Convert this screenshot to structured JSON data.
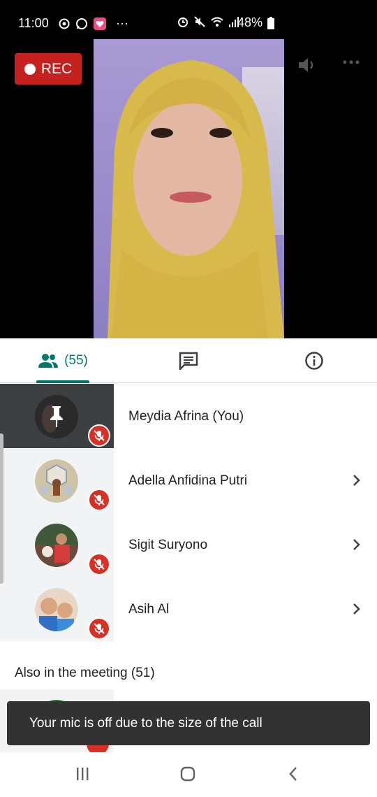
{
  "status_bar": {
    "time": "11:00",
    "overflow": "···",
    "battery": "48%",
    "icons_left": [
      "circle-play-icon",
      "whatsapp-icon",
      "heart-app-icon"
    ],
    "icons_right": [
      "alarm-icon",
      "mute-icon",
      "wifi-icon",
      "signal-icon",
      "battery-icon"
    ]
  },
  "video": {
    "rec_label": "REC",
    "controls": [
      "speaker-icon",
      "more-icon"
    ]
  },
  "tabs": {
    "people_count": "(55)",
    "items": [
      "people",
      "chat",
      "info"
    ],
    "accent": "#00796b"
  },
  "participants": [
    {
      "name": "Meydia Afrina (You)",
      "muted": true,
      "active": true,
      "pinned": true
    },
    {
      "name": "Adella Anfidina Putri",
      "muted": true,
      "active": false
    },
    {
      "name": "Sigit Suryono",
      "muted": true,
      "active": false
    },
    {
      "name": "Asih Al",
      "muted": true,
      "active": false
    }
  ],
  "also_in_meeting": "Also in the meeting (51)",
  "snackbar": "Your mic is off due to the size of the call",
  "nav": [
    "recent-apps-icon",
    "home-icon",
    "back-icon"
  ],
  "colors": {
    "rec": "#c5221f",
    "mute": "#d93025",
    "snackbar": "#323232"
  }
}
